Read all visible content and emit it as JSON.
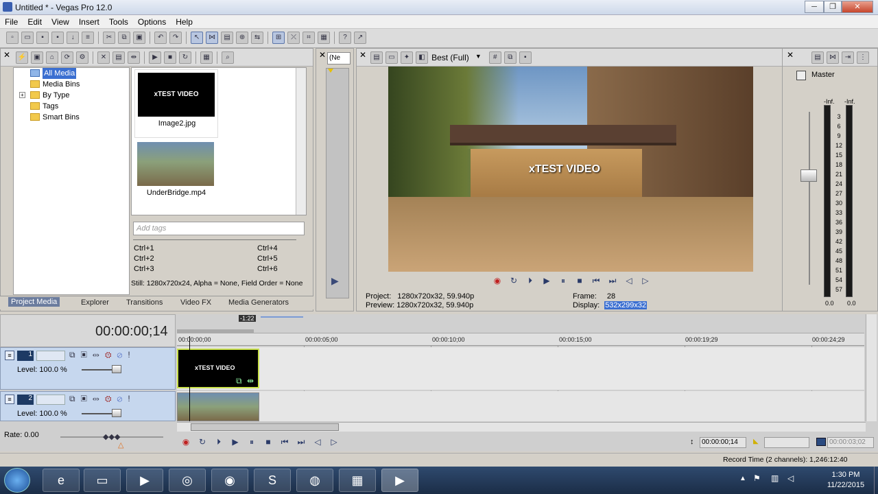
{
  "window": {
    "title": "Untitled * - Vegas Pro 12.0"
  },
  "menu": [
    "File",
    "Edit",
    "View",
    "Insert",
    "Tools",
    "Options",
    "Help"
  ],
  "explorer": {
    "tree": [
      "All Media",
      "Media Bins",
      "By Type",
      "Tags",
      "Smart Bins"
    ],
    "files": [
      {
        "name": "Image2.jpg",
        "thumb_text": "xTEST VIDEO"
      },
      {
        "name": "UnderBridge.mp4"
      }
    ],
    "tags_placeholder": "Add tags",
    "shortcuts_left": [
      "Ctrl+1",
      "Ctrl+2",
      "Ctrl+3"
    ],
    "shortcuts_right": [
      "Ctrl+4",
      "Ctrl+5",
      "Ctrl+6"
    ],
    "info": "Still: 1280x720x24, Alpha = None, Field Order = None",
    "tabs": [
      "Project Media",
      "Explorer",
      "Transitions",
      "Video FX",
      "Media Generators"
    ]
  },
  "trimmer": {
    "dropdown": "(Ne"
  },
  "preview": {
    "quality": "Best (Full)",
    "overlay_text": "xTEST VIDEO",
    "project_label": "Project:",
    "project_value": "1280x720x32, 59.940p",
    "preview_label": "Preview:",
    "preview_value": "1280x720x32, 59.940p",
    "frame_label": "Frame:",
    "frame_value": "28",
    "display_label": "Display:",
    "display_value": "532x299x32"
  },
  "mixer": {
    "title": "Master",
    "inf_left": "-Inf.",
    "inf_right": "-Inf.",
    "scale": [
      "3",
      "6",
      "9",
      "12",
      "15",
      "18",
      "21",
      "24",
      "27",
      "30",
      "33",
      "36",
      "39",
      "42",
      "45",
      "48",
      "51",
      "54",
      "57"
    ],
    "bottom_left": "0.0",
    "bottom_right": "0.0"
  },
  "timeline": {
    "time_display": "00:00:00;14",
    "loop_region": "-1:22",
    "ruler": [
      "00:00:00;00",
      "00:00:05;00",
      "00:00:10;00",
      "00:00:15;00",
      "00:00:19;29",
      "00:00:24;29"
    ],
    "tracks": [
      {
        "number": "1",
        "level": "Level: 100.0 %",
        "clip_text": "xTEST VIDEO"
      },
      {
        "number": "2",
        "level": "Level: 100.0 %"
      }
    ],
    "rate": "Rate: 0.00",
    "cursor_time": "00:00:00;14",
    "end_time": "00:00:03;02"
  },
  "status": {
    "record_time": "Record Time (2 channels): 1,246:12:40"
  },
  "taskbar": {
    "time": "1:30 PM",
    "date": "11/22/2015"
  }
}
